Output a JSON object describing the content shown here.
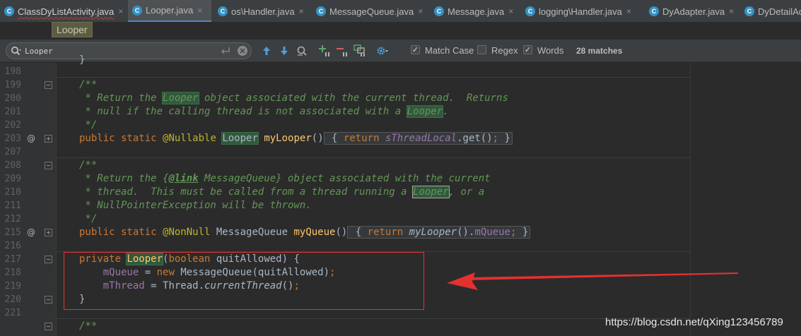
{
  "tabs": [
    {
      "label": "ClassDyListActivity.java",
      "active": false,
      "error": true
    },
    {
      "label": "Looper.java",
      "active": true,
      "error": false
    },
    {
      "label": "os\\Handler.java",
      "active": false,
      "error": false
    },
    {
      "label": "MessageQueue.java",
      "active": false,
      "error": false
    },
    {
      "label": "Message.java",
      "active": false,
      "error": false
    },
    {
      "label": "logging\\Handler.java",
      "active": false,
      "error": false
    },
    {
      "label": "DyAdapter.java",
      "active": false,
      "error": false
    },
    {
      "label": "DyDetailAc",
      "active": false,
      "error": false
    }
  ],
  "tab_icon_letter": "C",
  "tab_close_glyph": "×",
  "tooltip": "Looper",
  "find": {
    "query": "Looper",
    "options": [
      {
        "label": "Match Case",
        "checked": true
      },
      {
        "label": "Regex",
        "checked": false
      },
      {
        "label": "Words",
        "checked": true
      }
    ],
    "matches": "28 matches"
  },
  "gutter": {
    "lines": [
      "198",
      "199",
      "200",
      "201",
      "202",
      "203",
      "207",
      "208",
      "209",
      "210",
      "211",
      "212",
      "215",
      "216",
      "217",
      "218",
      "219",
      "220",
      "221"
    ],
    "override_marker": "@"
  },
  "code": {
    "l198": "}",
    "l199": "/**",
    "l200": [
      " * Return the ",
      "Looper",
      " object associated with the current thread.  Returns"
    ],
    "l201": [
      " * null if the calling thread is not associated with a ",
      "Looper",
      "."
    ],
    "l202": " */",
    "l203": [
      "public static ",
      "@Nullable",
      " ",
      "Looper",
      " ",
      "myLooper",
      "()",
      " { ",
      "return ",
      "sThreadLocal",
      ".get()",
      ";",
      " }"
    ],
    "l207": "/**",
    "l208": [
      " * Return the {",
      "@link",
      " MessageQueue} object associated with the current"
    ],
    "l209": [
      " * thread.  This must be called from a thread running a ",
      "Looper",
      ", or a"
    ],
    "l210": " * NullPointerException will be thrown.",
    "l211": " */",
    "l212": [
      "public static ",
      "@NonNull",
      " MessageQueue ",
      "myQueue",
      "()",
      " { ",
      "return ",
      "myLooper",
      "().",
      "mQueue",
      ";",
      " }"
    ],
    "l216": [
      "private ",
      "Looper",
      "(",
      "boolean",
      " quitAllowed) {"
    ],
    "l217": [
      "    ",
      "mQueue",
      " = ",
      "new ",
      "MessageQueue(quitAllowed)",
      ";"
    ],
    "l218": [
      "    ",
      "mThread",
      " = Thread.",
      "currentThread",
      "()",
      ";"
    ],
    "l219": "}",
    "l221": "/**"
  },
  "colors": {
    "keyword": "#cc7832",
    "comment": "#629755",
    "annotation": "#bbb529",
    "method": "#ffc66d",
    "field": "#9876aa",
    "match_highlight": "#32593d",
    "annotation_box": "#e53030"
  },
  "watermark": "https://blog.csdn.net/qXing123456789"
}
